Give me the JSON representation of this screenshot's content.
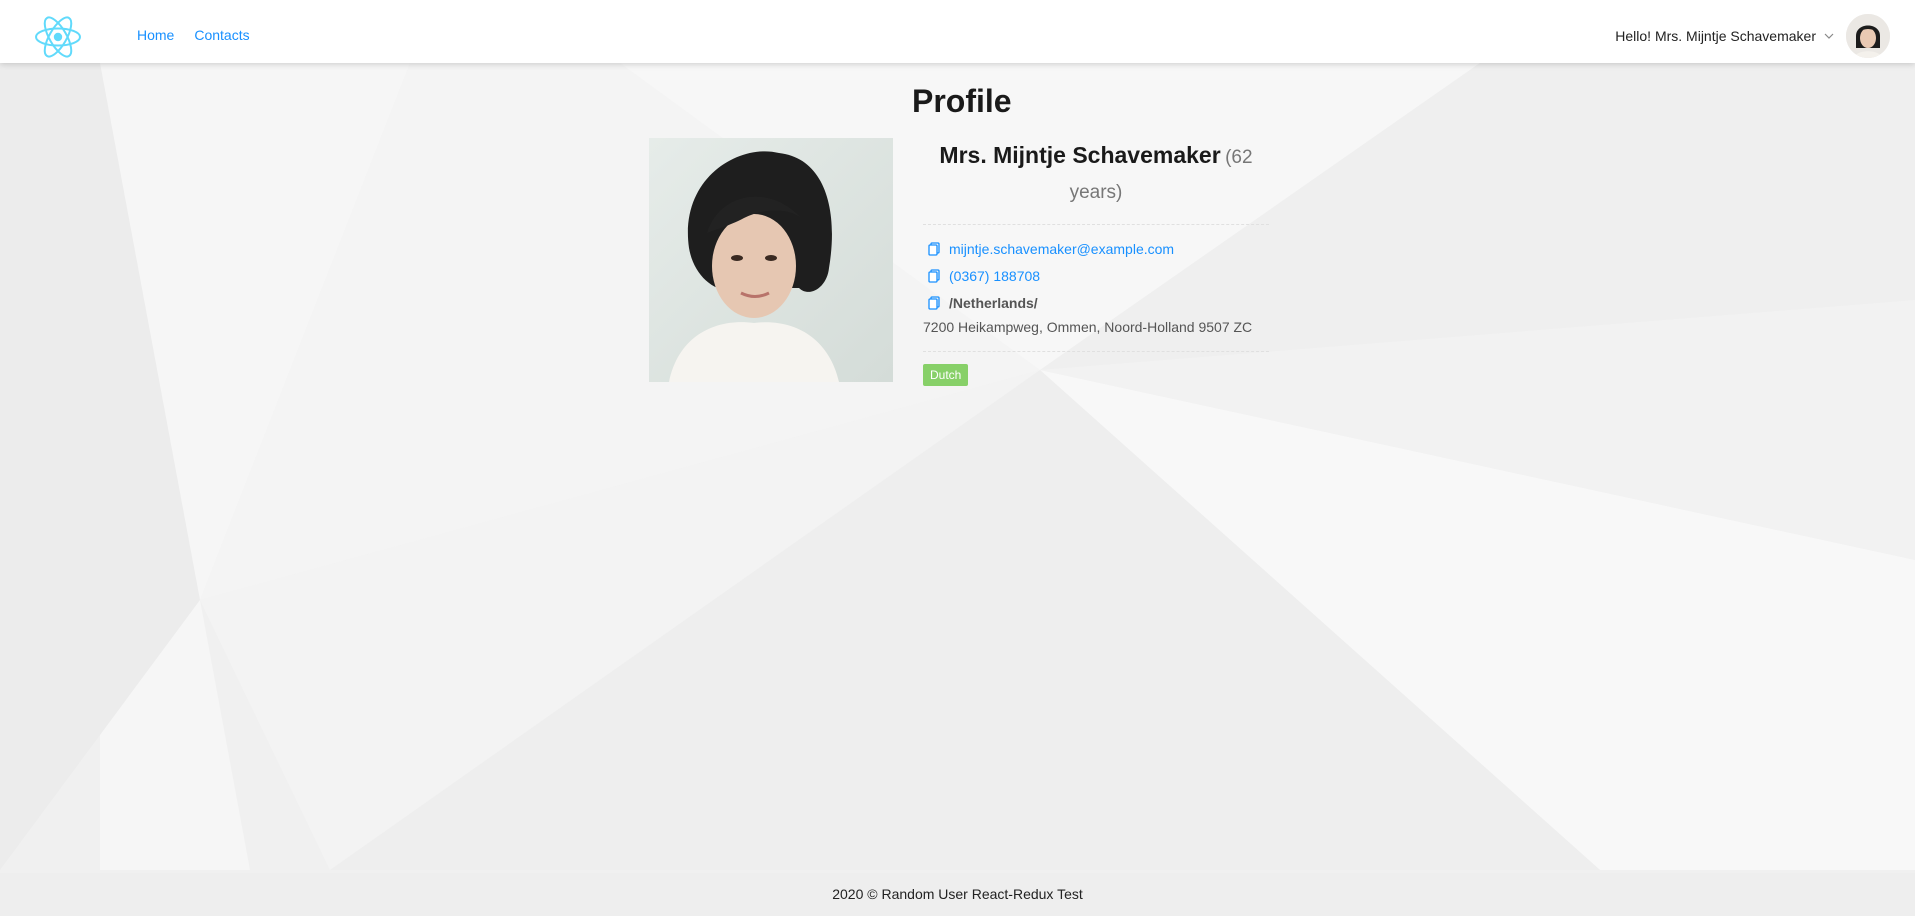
{
  "header": {
    "logo_icon": "react-atom-icon",
    "nav": [
      {
        "label": "Home"
      },
      {
        "label": "Contacts"
      }
    ],
    "greeting": "Hello! Mrs. Mijntje Schavemaker"
  },
  "profile": {
    "title": "Profile",
    "name": "Mrs. Mijntje Schavemaker",
    "age": "(62 years)",
    "email": "mijntje.schavemaker@example.com",
    "phone": "(0367) 188708",
    "country": "/Netherlands/",
    "address": "7200 Heikampweg, Ommen, Noord-Holland 9507 ZC",
    "nationality_tag": "Dutch"
  },
  "footer": {
    "text": "2020 © Random User React-Redux Test"
  },
  "colors": {
    "link": "#1890ff",
    "tag": "#87d068",
    "logo": "#61dafb"
  }
}
